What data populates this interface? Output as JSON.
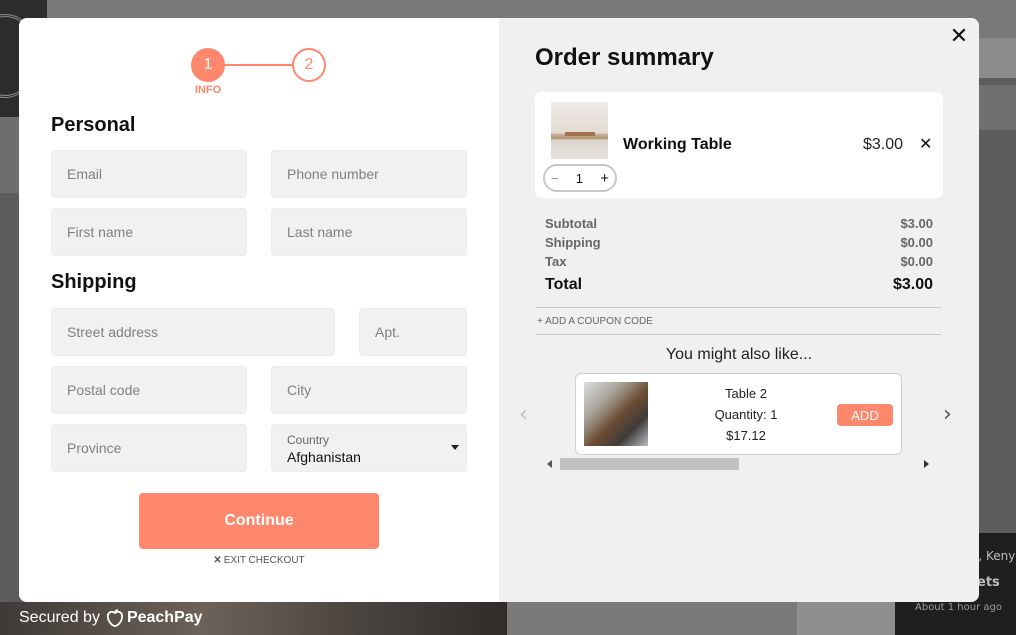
{
  "background": {
    "toast": {
      "line1": "i, Keny",
      "line2": "ets",
      "time": "About 1 hour ago"
    }
  },
  "footer": {
    "secured_prefix": "Secured by",
    "brand": "PeachPay"
  },
  "stepper": {
    "step1": "1",
    "step2": "2",
    "step1_label": "INFO"
  },
  "personal": {
    "title": "Personal",
    "email_placeholder": "Email",
    "phone_placeholder": "Phone number",
    "first_name_placeholder": "First name",
    "last_name_placeholder": "Last name"
  },
  "shipping": {
    "title": "Shipping",
    "street_placeholder": "Street address",
    "apt_placeholder": "Apt.",
    "postal_placeholder": "Postal code",
    "city_placeholder": "City",
    "province_placeholder": "Province",
    "country_label": "Country",
    "country_value": "Afghanistan"
  },
  "actions": {
    "continue_label": "Continue",
    "exit_label": "EXIT CHECKOUT",
    "exit_icon": "✕"
  },
  "summary": {
    "title": "Order summary",
    "close_icon": "✕",
    "item": {
      "name": "Working Table",
      "price": "$3.00",
      "remove_icon": "✕",
      "quantity": "1",
      "minus": "−",
      "plus": "+"
    },
    "subtotal_label": "Subtotal",
    "subtotal_value": "$3.00",
    "shipping_label": "Shipping",
    "shipping_value": "$0.00",
    "tax_label": "Tax",
    "tax_value": "$0.00",
    "total_label": "Total",
    "total_value": "$3.00",
    "coupon_label": "+ ADD A COUPON CODE"
  },
  "upsell": {
    "title": "You might also like...",
    "prev_icon": "‹",
    "next_icon": "›",
    "product": {
      "name": "Table 2",
      "quantity": "Quantity: 1",
      "price": "$17.12",
      "add_label": "ADD"
    }
  },
  "colors": {
    "accent": "#ff876c",
    "right_panel": "#f0f0f0",
    "input_bg": "#f1f1f1"
  }
}
